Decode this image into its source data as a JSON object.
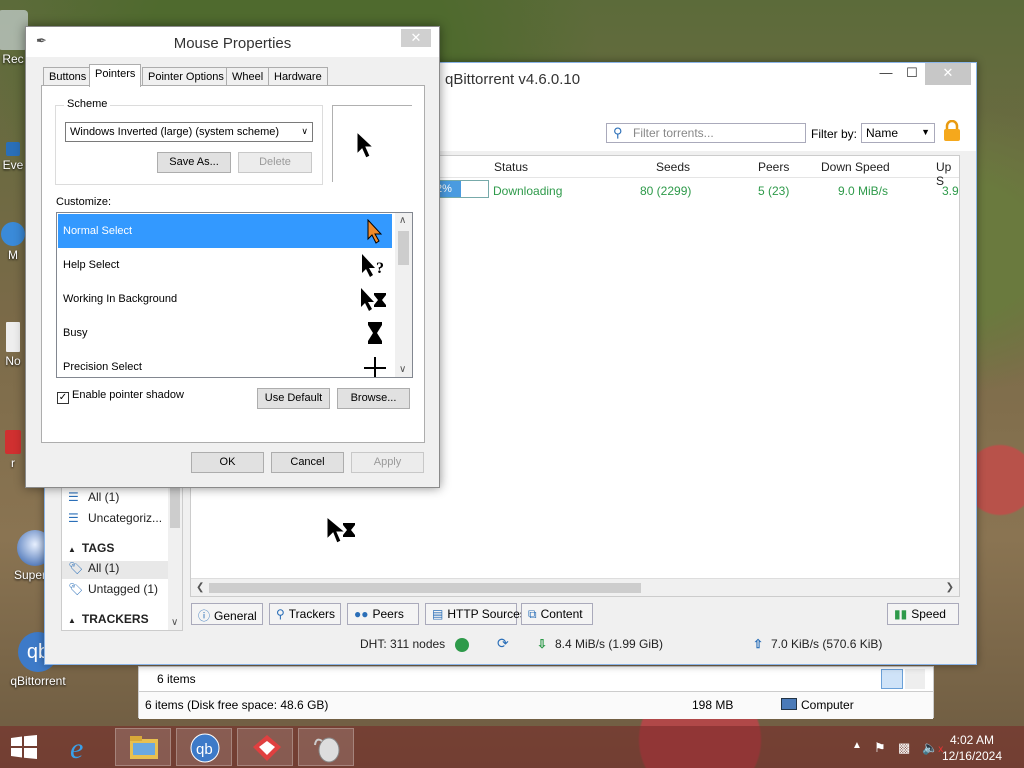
{
  "desktop": {
    "icons": [
      {
        "label": "Rec",
        "icon": "recycle-bin-icon"
      },
      {
        "label": "Eve",
        "icon": "app-icon"
      },
      {
        "label": "M",
        "icon": "app-icon"
      },
      {
        "label": "No",
        "icon": "notepad-icon"
      },
      {
        "label": "r",
        "icon": "app-icon"
      },
      {
        "label": "Superm",
        "icon": "app-icon"
      },
      {
        "label": "qBittorrent",
        "icon": "qbittorrent-icon"
      }
    ]
  },
  "qbittorrent": {
    "title": "qBittorrent v4.6.0.10",
    "search_placeholder": "Filter torrents...",
    "filter_by_label": "Filter by:",
    "filter_by_value": "Name",
    "columns": [
      "Status",
      "Seeds",
      "Peers",
      "Down Speed",
      "Up S"
    ],
    "torrent": {
      "progress_text": "2%",
      "progress_fraction": 0.48,
      "status": "Downloading",
      "seeds": "80 (2299)",
      "peers": "5 (23)",
      "down_speed": "9.0 MiB/s",
      "up_speed": "3.9"
    },
    "sidebar": {
      "categories": [
        {
          "label": "All (1)"
        },
        {
          "label": "Uncategoriz..."
        }
      ],
      "tags_header": "TAGS",
      "tags": [
        {
          "label": "All (1)"
        },
        {
          "label": "Untagged (1)"
        }
      ],
      "trackers_header": "TRACKERS"
    },
    "bottom_tabs": [
      {
        "label": "General",
        "icon": "info-icon"
      },
      {
        "label": "Trackers",
        "icon": "location-pin-icon"
      },
      {
        "label": "Peers",
        "icon": "people-icon"
      },
      {
        "label": "HTTP Sources",
        "icon": "server-icon"
      },
      {
        "label": "Content",
        "icon": "content-icon"
      }
    ],
    "speed_button": "Speed",
    "status_bar": {
      "dht": "DHT: 311 nodes",
      "download": "8.4 MiB/s (1.99 GiB)",
      "upload": "7.0 KiB/s (570.6 KiB)"
    }
  },
  "explorer": {
    "items_count": "6 items",
    "status_left": "6 items (Disk free space: 48.6 GB)",
    "status_size": "198 MB",
    "status_location": "Computer"
  },
  "mouse_properties": {
    "title": "Mouse Properties",
    "tabs": [
      "Buttons",
      "Pointers",
      "Pointer Options",
      "Wheel",
      "Hardware"
    ],
    "active_tab": "Pointers",
    "scheme_label": "Scheme",
    "scheme_value": "Windows Inverted (large) (system scheme)",
    "save_as": "Save As...",
    "delete": "Delete",
    "customize_label": "Customize:",
    "pointers": [
      {
        "label": "Normal Select",
        "icon": "arrow-cursor-icon"
      },
      {
        "label": "Help Select",
        "icon": "help-cursor-icon"
      },
      {
        "label": "Working In Background",
        "icon": "working-cursor-icon"
      },
      {
        "label": "Busy",
        "icon": "hourglass-icon"
      },
      {
        "label": "Precision Select",
        "icon": "crosshair-icon"
      }
    ],
    "selected_pointer_index": 0,
    "enable_shadow_label": "Enable pointer shadow",
    "enable_shadow_checked": true,
    "use_default": "Use Default",
    "browse": "Browse...",
    "ok": "OK",
    "cancel": "Cancel",
    "apply": "Apply"
  },
  "taskbar": {
    "items": [
      "internet-explorer-icon",
      "file-explorer-icon",
      "qbittorrent-icon",
      "app-icon",
      "mouse-icon"
    ],
    "time": "4:02 AM",
    "date": "12/16/2024"
  }
}
